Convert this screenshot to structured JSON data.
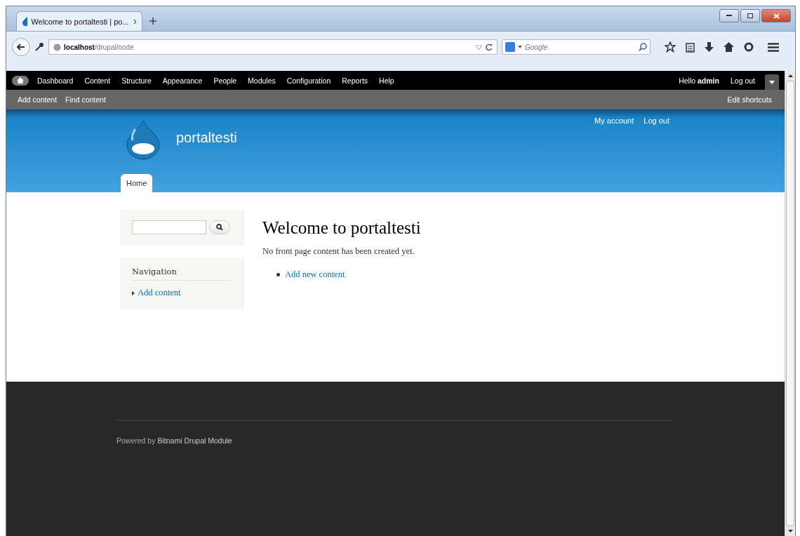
{
  "browser": {
    "tab_title": "Welcome to portaltesti | po...",
    "url_host": "localhost",
    "url_path": "/drupal/node",
    "search_placeholder": "Google"
  },
  "admin_toolbar": {
    "items": [
      "Dashboard",
      "Content",
      "Structure",
      "Appearance",
      "People",
      "Modules",
      "Configuration",
      "Reports",
      "Help"
    ],
    "greeting": "Hello",
    "user": "admin",
    "logout": "Log out"
  },
  "shortcuts": {
    "items": [
      "Add content",
      "Find content"
    ],
    "edit": "Edit shortcuts"
  },
  "header": {
    "site_name": "portaltesti",
    "secondary_links": [
      "My account",
      "Log out"
    ],
    "tabs": [
      {
        "label": "Home",
        "selected": true
      }
    ]
  },
  "sidebar": {
    "navigation": {
      "title": "Navigation",
      "links": [
        "Add content"
      ]
    }
  },
  "main": {
    "title": "Welcome to portaltesti",
    "message": "No front page content has been created yet.",
    "links": [
      "Add new content"
    ]
  },
  "footer": {
    "prefix": "Powered by",
    "link": "Bitnami Drupal Module"
  }
}
